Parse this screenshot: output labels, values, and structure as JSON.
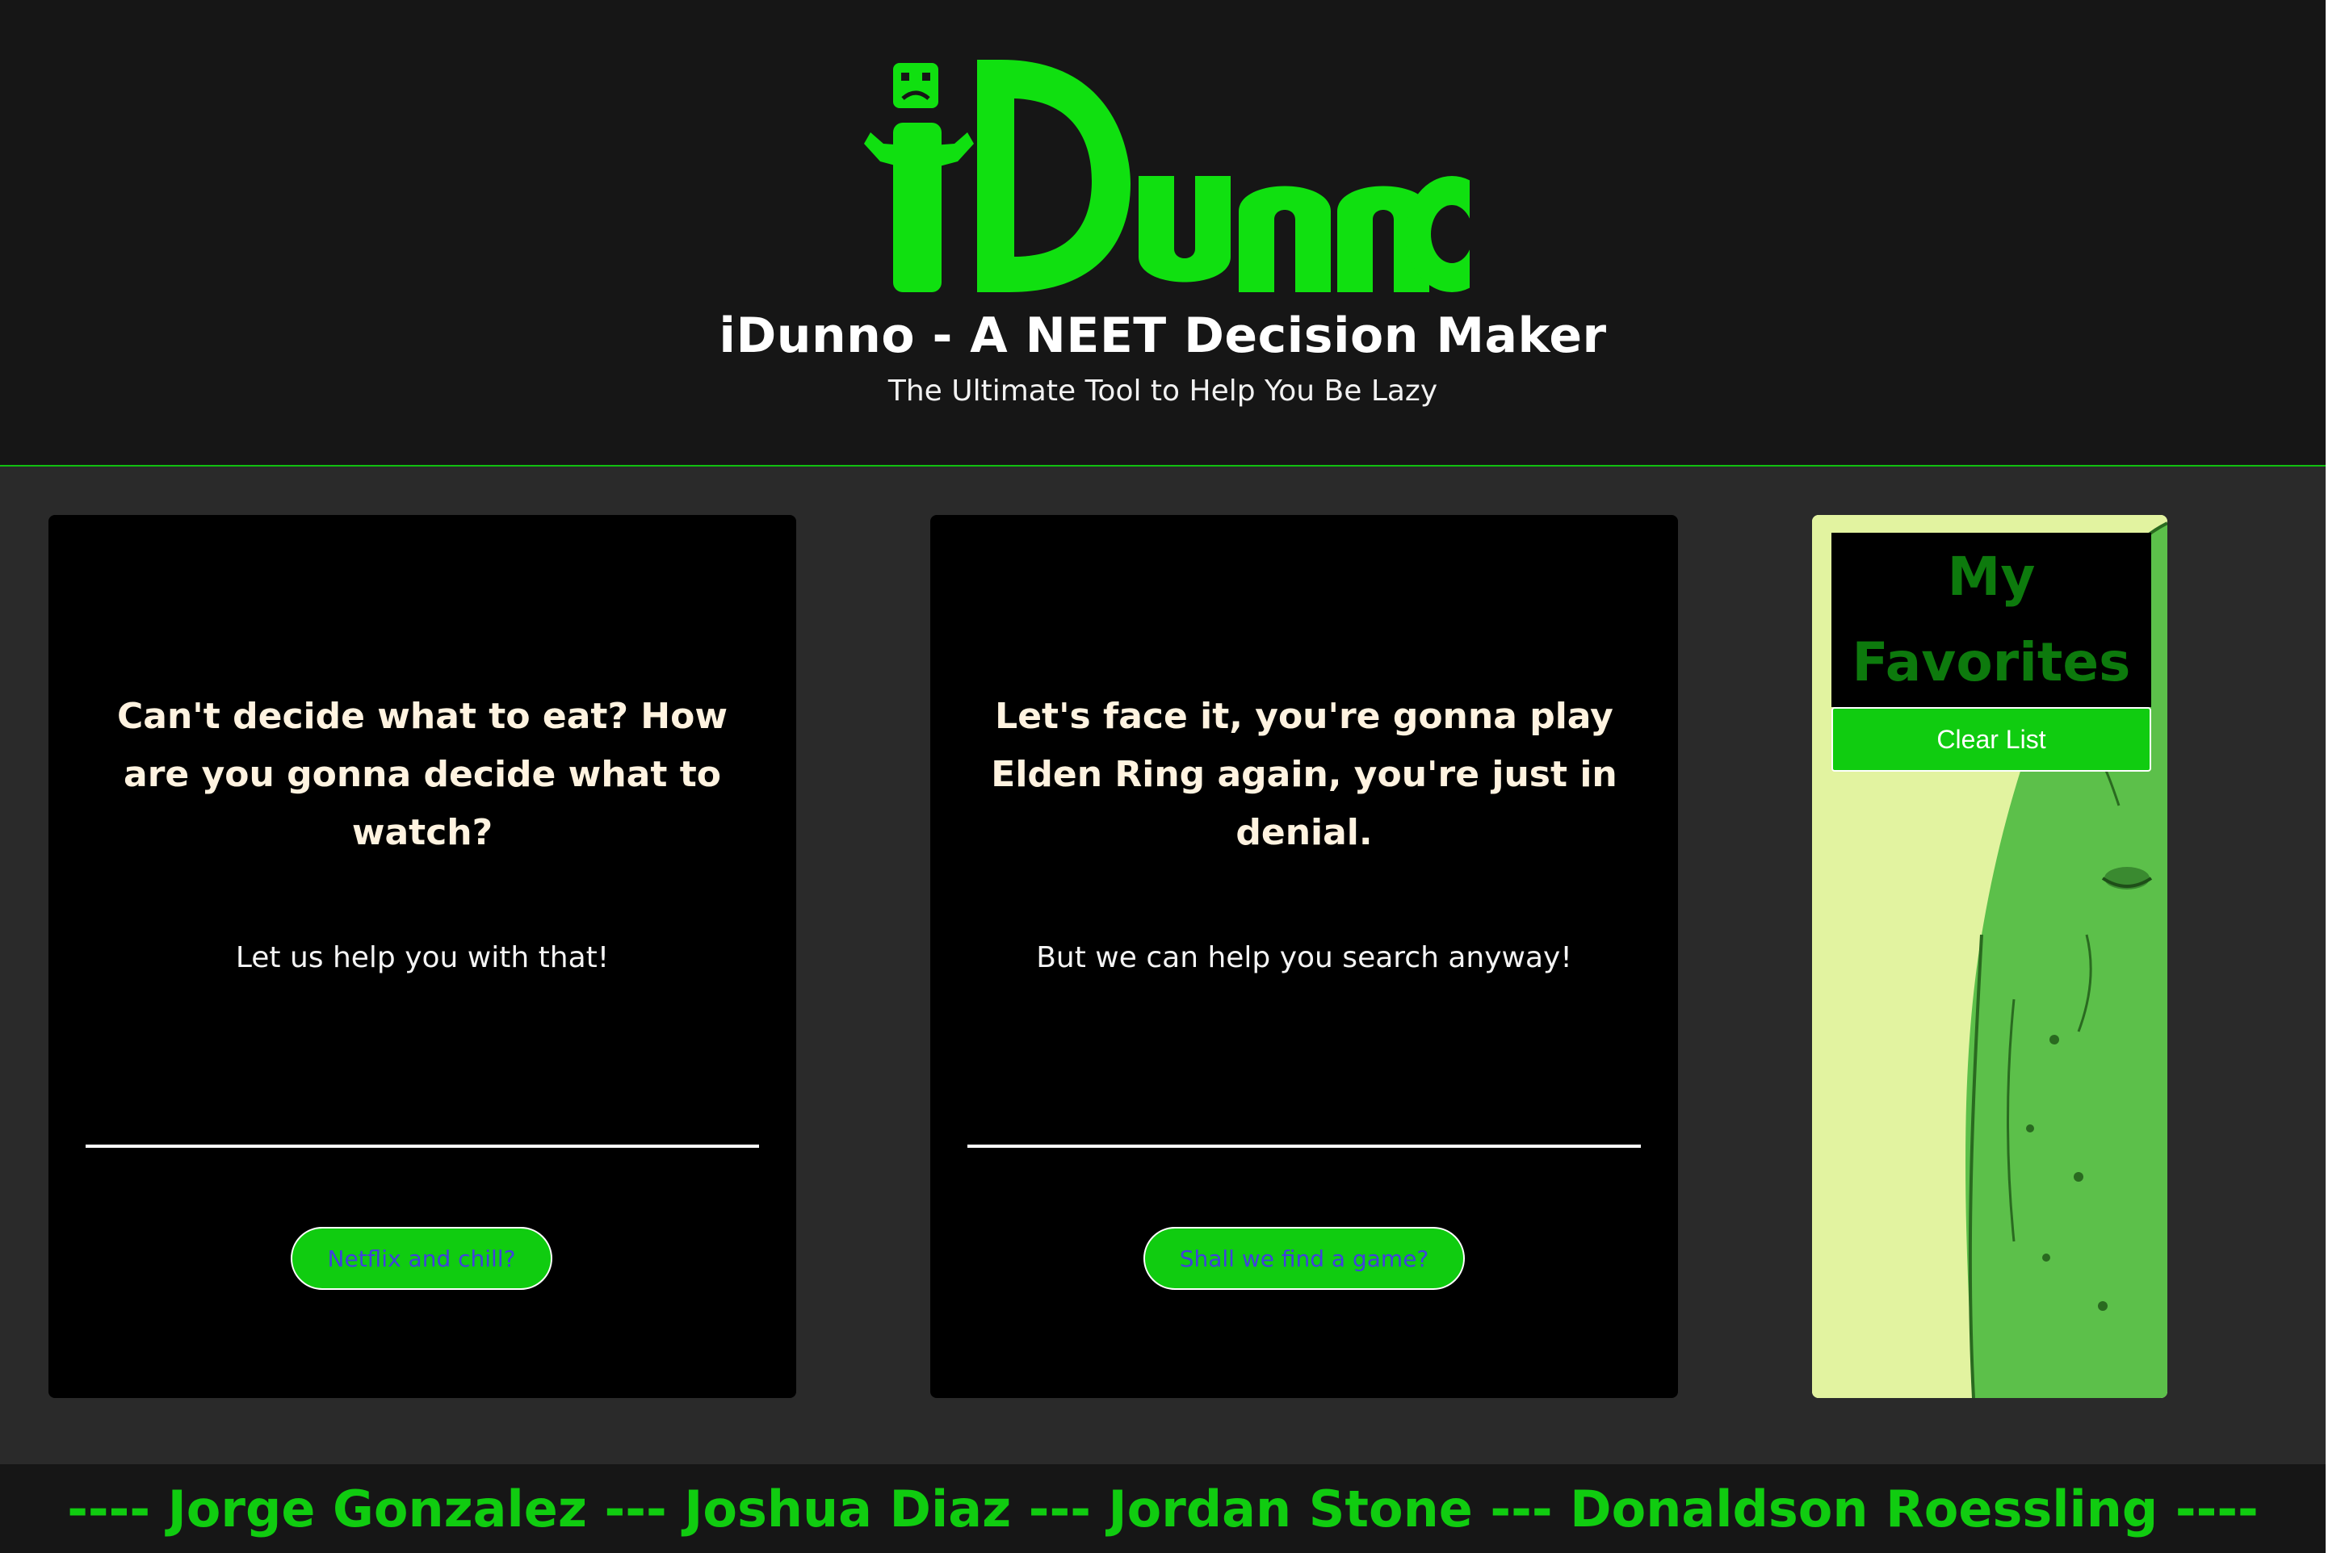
{
  "header": {
    "logo_text": "iDunno",
    "title": "iDunno - A NEET Decision Maker",
    "subtitle": "The Ultimate Tool to Help You Be Lazy"
  },
  "cards": [
    {
      "question": "Can't decide what to eat? How are you gonna decide what to watch?",
      "help_text": "Let us help you with that!",
      "input_value": "",
      "button_label": "Netflix and chill?"
    },
    {
      "question": "Let's face it, you're gonna play Elden Ring again, you're just in denial.",
      "help_text": "But we can help you search anyway!",
      "input_value": "",
      "button_label": "Shall we find a game?"
    }
  ],
  "favorites": {
    "title": "My Favorites",
    "clear_label": "Clear List",
    "background_image": "green-pickle-character-illustration"
  },
  "footer": {
    "credits": "---- Jorge Gonzalez --- Joshua Diaz --- Jordan Stone --- Donaldson Roessling ----"
  },
  "colors": {
    "accent": "#10cc10",
    "header_bg": "#161616",
    "page_bg": "#2a2a2a",
    "card_bg": "#000000",
    "favorites_title": "#0d7a0d",
    "button_text": "#4040dd"
  }
}
